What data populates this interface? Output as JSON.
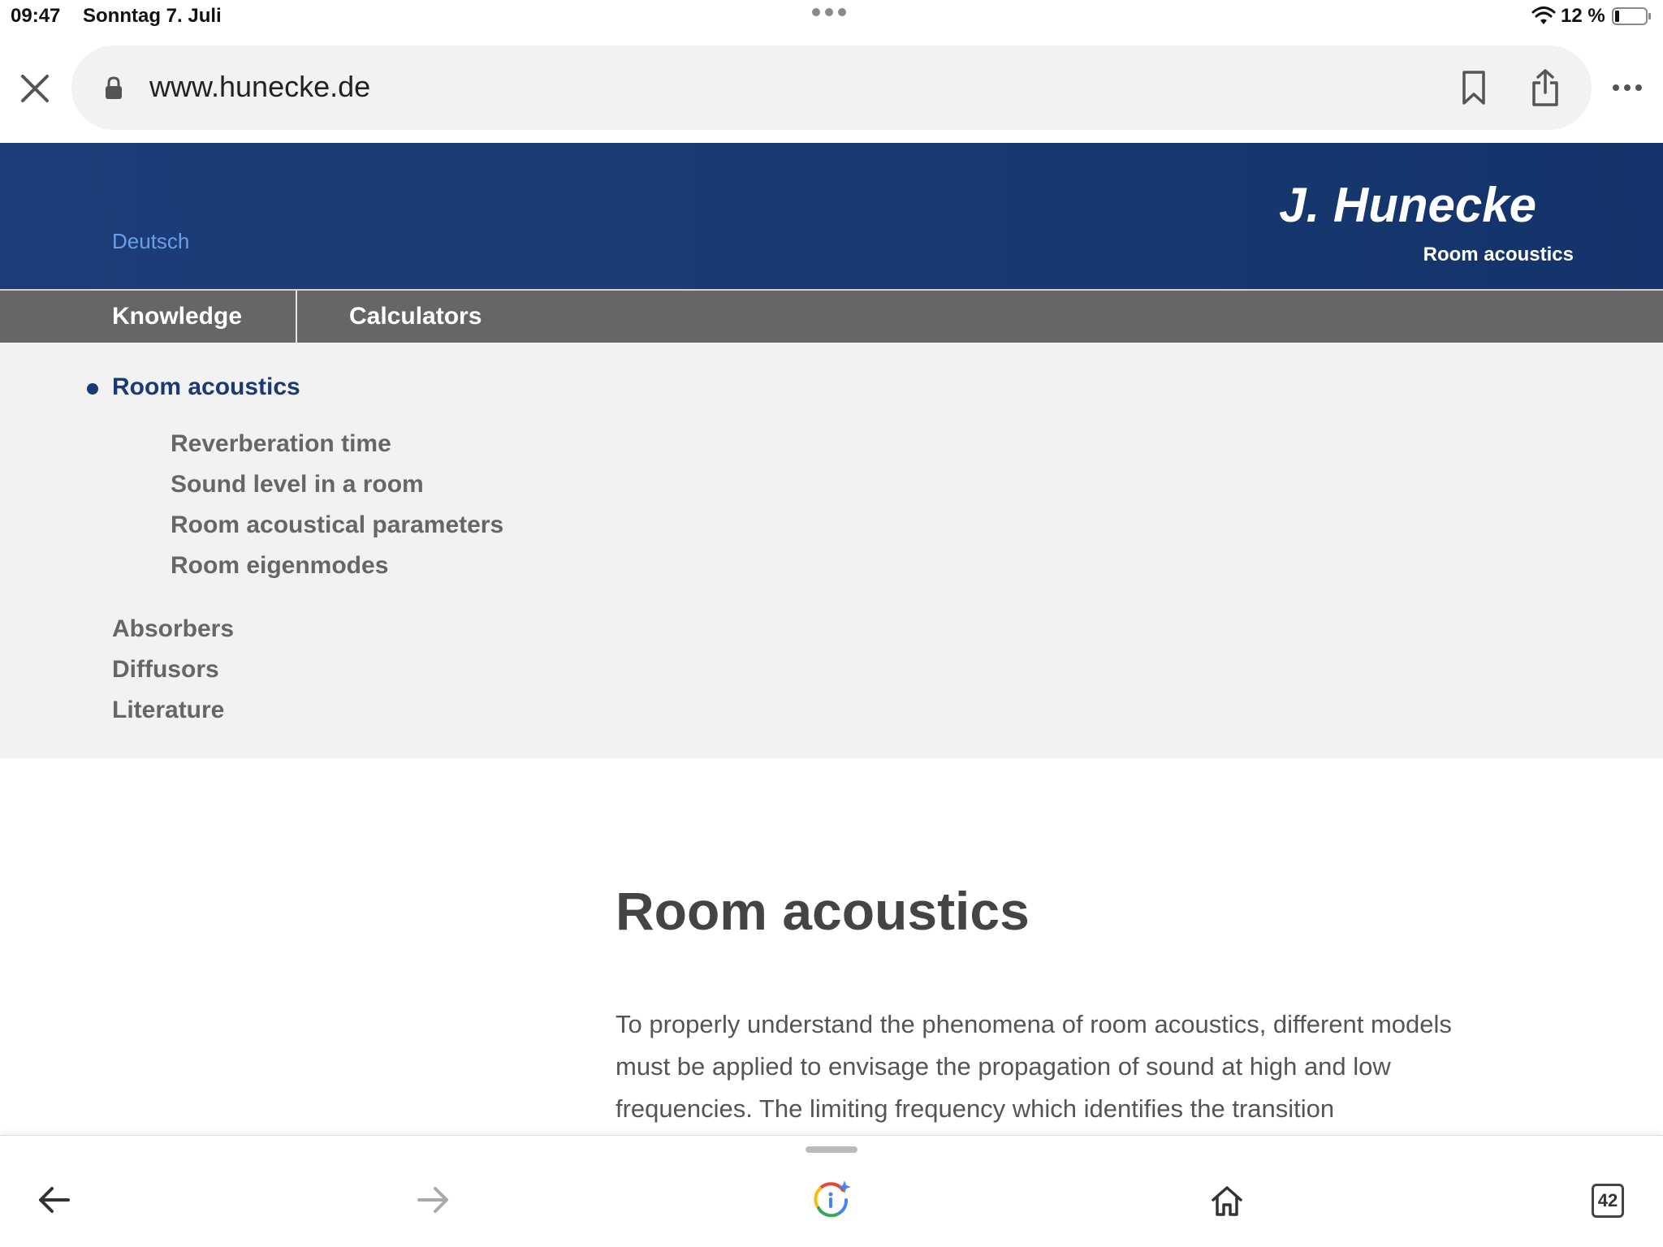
{
  "status_bar": {
    "time": "09:47",
    "date": "Sonntag 7. Juli",
    "battery": "12 %"
  },
  "browser": {
    "url": "www.hunecke.de",
    "tab_count": "42"
  },
  "header": {
    "language_link": "Deutsch",
    "brand": "J. Hunecke",
    "brand_subtitle": "Room acoustics"
  },
  "nav": {
    "items": [
      {
        "label": "Knowledge"
      },
      {
        "label": "Calculators"
      }
    ]
  },
  "menu": {
    "active": "Room acoustics",
    "sub_items": [
      {
        "label": "Reverberation time"
      },
      {
        "label": "Sound level in a room"
      },
      {
        "label": "Room acoustical parameters"
      },
      {
        "label": "Room eigenmodes"
      }
    ],
    "top_items": [
      {
        "label": "Absorbers"
      },
      {
        "label": "Diffusors"
      },
      {
        "label": "Literature"
      }
    ]
  },
  "content": {
    "title": "Room acoustics",
    "paragraph": "To properly understand the phenomena of room acoustics, different models must be applied to envisage the propagation of sound at high and low frequencies. The limiting frequency which identifies the transition"
  },
  "colors": {
    "header_blue": "#1a3a73",
    "nav_gray": "#666666",
    "menu_bg": "#f2f2f2",
    "link_blue": "#6a9fe3"
  }
}
